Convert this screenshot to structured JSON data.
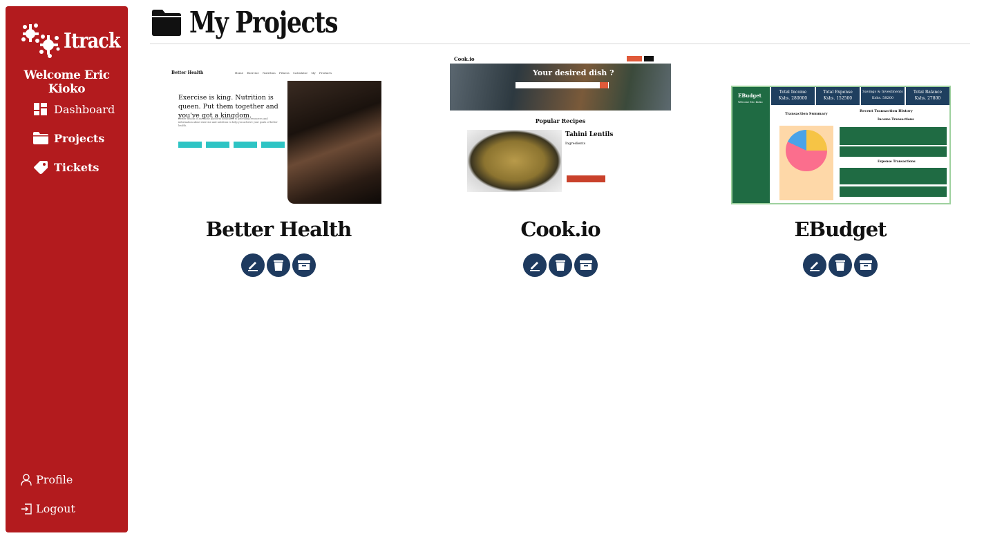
{
  "app": {
    "brand": "Itrack",
    "welcome": "Welcome Eric Kioko"
  },
  "sidebar": {
    "nav": [
      {
        "label": "Dashboard",
        "icon": "dashboard-icon"
      },
      {
        "label": "Projects",
        "icon": "folder-icon"
      },
      {
        "label": "Tickets",
        "icon": "tag-icon"
      }
    ],
    "footer": [
      {
        "label": "Profile",
        "icon": "user-icon"
      },
      {
        "label": "Logout",
        "icon": "logout-icon"
      }
    ]
  },
  "main": {
    "title": "My Projects"
  },
  "projects": [
    {
      "name": "Better Health",
      "thumb": {
        "logo": "Better Health",
        "links": "Home  Exercise  Nutrition  Fitness Calculator  My Products",
        "headline": "Exercise is king. Nutrition is queen. Put them together and you've got a kingdom.",
        "body": "Better Health is an online platform dedicated to providing resources and information about exercise and nutrition to help you achieve your goals of better health.",
        "cta": "Please feel free to explore our available resources below."
      }
    },
    {
      "name": "Cook.io",
      "thumb": {
        "logo": "Cook.io",
        "hero_title": "Your desired dish ?",
        "popular": "Popular Recipes",
        "recipe": "Tahini Lentils",
        "ingredients": "Ingredients"
      }
    },
    {
      "name": "EBudget",
      "thumb": {
        "logo": "EBudget",
        "user": "Welcome Eric Kioko",
        "stats": [
          {
            "label": "Total Income",
            "value": "Kshs. 280000"
          },
          {
            "label": "Total Expense",
            "value": "Kshs. 152500"
          },
          {
            "label": "Savings & Investments",
            "value": "Kshs. 58200"
          },
          {
            "label": "Total Balance",
            "value": "Kshs. 27800"
          }
        ],
        "summary": "Transaction Summary",
        "history": "Recent Transaction History",
        "income": "Income Transactions",
        "expense": "Expense Transactions"
      }
    }
  ],
  "actions": {
    "edit": "edit-icon",
    "delete": "trash-icon",
    "archive": "archive-icon"
  },
  "colors": {
    "sidebar": "#b31b1e",
    "action": "#1e3a5f"
  }
}
